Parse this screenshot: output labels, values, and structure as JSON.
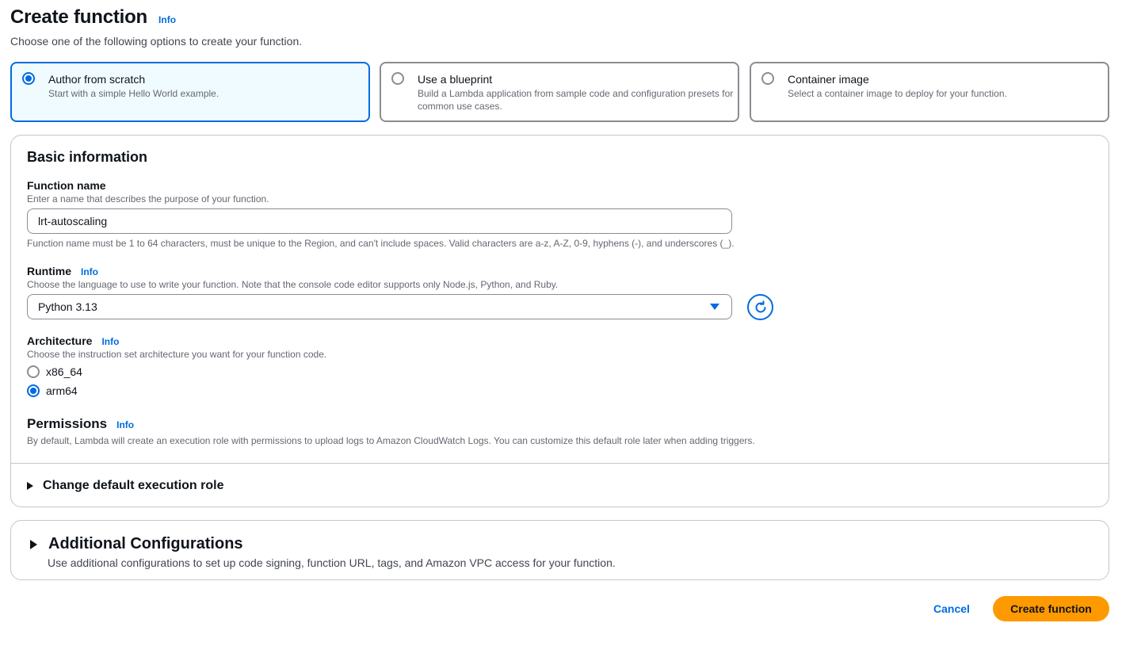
{
  "header": {
    "title": "Create function",
    "info": "Info",
    "subtitle": "Choose one of the following options to create your function."
  },
  "options": [
    {
      "title": "Author from scratch",
      "description": "Start with a simple Hello World example.",
      "selected": true
    },
    {
      "title": "Use a blueprint",
      "description": "Build a Lambda application from sample code and configuration presets for common use cases.",
      "selected": false
    },
    {
      "title": "Container image",
      "description": "Select a container image to deploy for your function.",
      "selected": false
    }
  ],
  "basic": {
    "title": "Basic information",
    "function_name": {
      "label": "Function name",
      "description": "Enter a name that describes the purpose of your function.",
      "value": "lrt-autoscaling",
      "constraint": "Function name must be 1 to 64 characters, must be unique to the Region, and can't include spaces. Valid characters are a-z, A-Z, 0-9, hyphens (-), and underscores (_)."
    },
    "runtime": {
      "label": "Runtime",
      "info": "Info",
      "description": "Choose the language to use to write your function. Note that the console code editor supports only Node.js, Python, and Ruby.",
      "value": "Python 3.13"
    },
    "architecture": {
      "label": "Architecture",
      "info": "Info",
      "description": "Choose the instruction set architecture you want for your function code.",
      "options": [
        {
          "label": "x86_64",
          "checked": false
        },
        {
          "label": "arm64",
          "checked": true
        }
      ]
    },
    "permissions": {
      "title": "Permissions",
      "info": "Info",
      "description": "By default, Lambda will create an execution role with permissions to upload logs to Amazon CloudWatch Logs. You can customize this default role later when adding triggers."
    },
    "change_role_label": "Change default execution role"
  },
  "additional": {
    "title": "Additional Configurations",
    "description": "Use additional configurations to set up code signing, function URL, tags, and Amazon VPC access for your function."
  },
  "footer": {
    "cancel_label": "Cancel",
    "create_label": "Create function"
  },
  "colors": {
    "accent": "#006ce0",
    "primary_button": "#ff9900"
  }
}
